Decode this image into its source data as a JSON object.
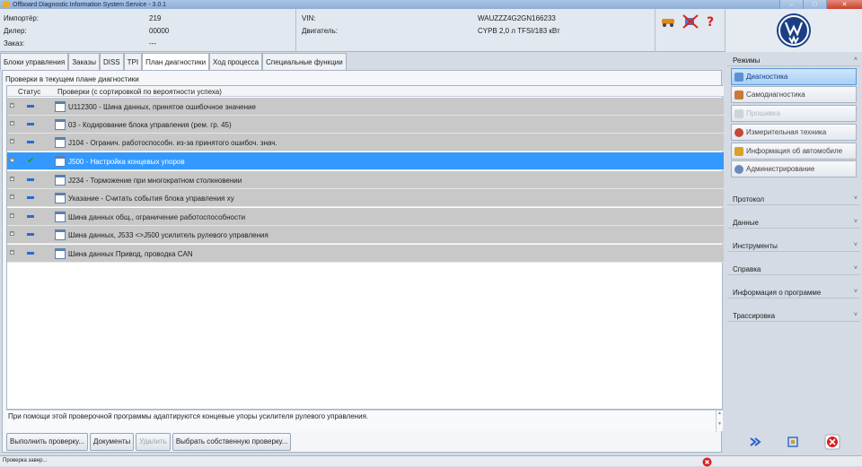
{
  "window": {
    "title": "Offboard Diagnostic Information System Service - 3.0.1"
  },
  "header": {
    "importer_label": "Импортёр:",
    "importer_value": "219",
    "dealer_label": "Дилер:",
    "dealer_value": "00000",
    "order_label": "Заказ:",
    "order_value": "---",
    "vin_label": "VIN:",
    "vin_value": "WAUZZZ4G2GN166233",
    "engine_label": "Двигатель:",
    "engine_value": "CYPB 2,0 л TFSI/183 кВт"
  },
  "tabs": [
    {
      "label": "Блоки управления"
    },
    {
      "label": "Заказы"
    },
    {
      "label": "DISS"
    },
    {
      "label": "TPI"
    },
    {
      "label": "План диагностики"
    },
    {
      "label": "Ход процесса"
    },
    {
      "label": "Специальные функции"
    }
  ],
  "plan": {
    "caption": "Проверки в текущем плане диагностики",
    "col_status": "Статус",
    "col_checks": "Проверки (с сортировкой по вероятности успеха)",
    "rows": [
      {
        "text": "U112300 - Шина данных, принятое ошибочное значение"
      },
      {
        "text": "03 - Кодирование блока управления (рем. гр. 45)"
      },
      {
        "text": "J104 - Огранич. работоспособн. из-за принятого ошибоч. знач."
      },
      {
        "text": "J500 - Настройка концевых упоров"
      },
      {
        "text": "J234 - Торможение при многократном столкновении"
      },
      {
        "text": "Указание - Считать события блока управления xy"
      },
      {
        "text": "Шина данных общ., ограничение работоспособности"
      },
      {
        "text": "Шина данных, J533 <>J500 усилитель рулевого управления"
      },
      {
        "text": "Шина данных Привод, проводка CAN"
      }
    ],
    "description": "При помощи этой проверочной программы адаптируются концевые упоры усилителя рулевого управления."
  },
  "buttons": {
    "execute": "Выполнить проверку...",
    "documents": "Документы",
    "delete": "Удалить",
    "choose_own": "Выбрать собственную проверку..."
  },
  "sidebar": {
    "modes_title": "Режимы",
    "modes": [
      {
        "label": "Диагностика"
      },
      {
        "label": "Самодиагностика"
      },
      {
        "label": "Прошивка"
      },
      {
        "label": "Измерительная техника"
      },
      {
        "label": "Информация об автомобиле"
      },
      {
        "label": "Администрирование"
      }
    ],
    "sections": [
      {
        "label": "Протокол"
      },
      {
        "label": "Данные"
      },
      {
        "label": "Инструменты"
      },
      {
        "label": "Справка"
      },
      {
        "label": "Информация о программе"
      },
      {
        "label": "Трассировка"
      }
    ]
  },
  "status": {
    "text": "Проверка завер..."
  },
  "colors": {
    "selection": "#3399ff",
    "row_bg": "#c8c8c8",
    "accent_blue": "#2a6bd1"
  }
}
